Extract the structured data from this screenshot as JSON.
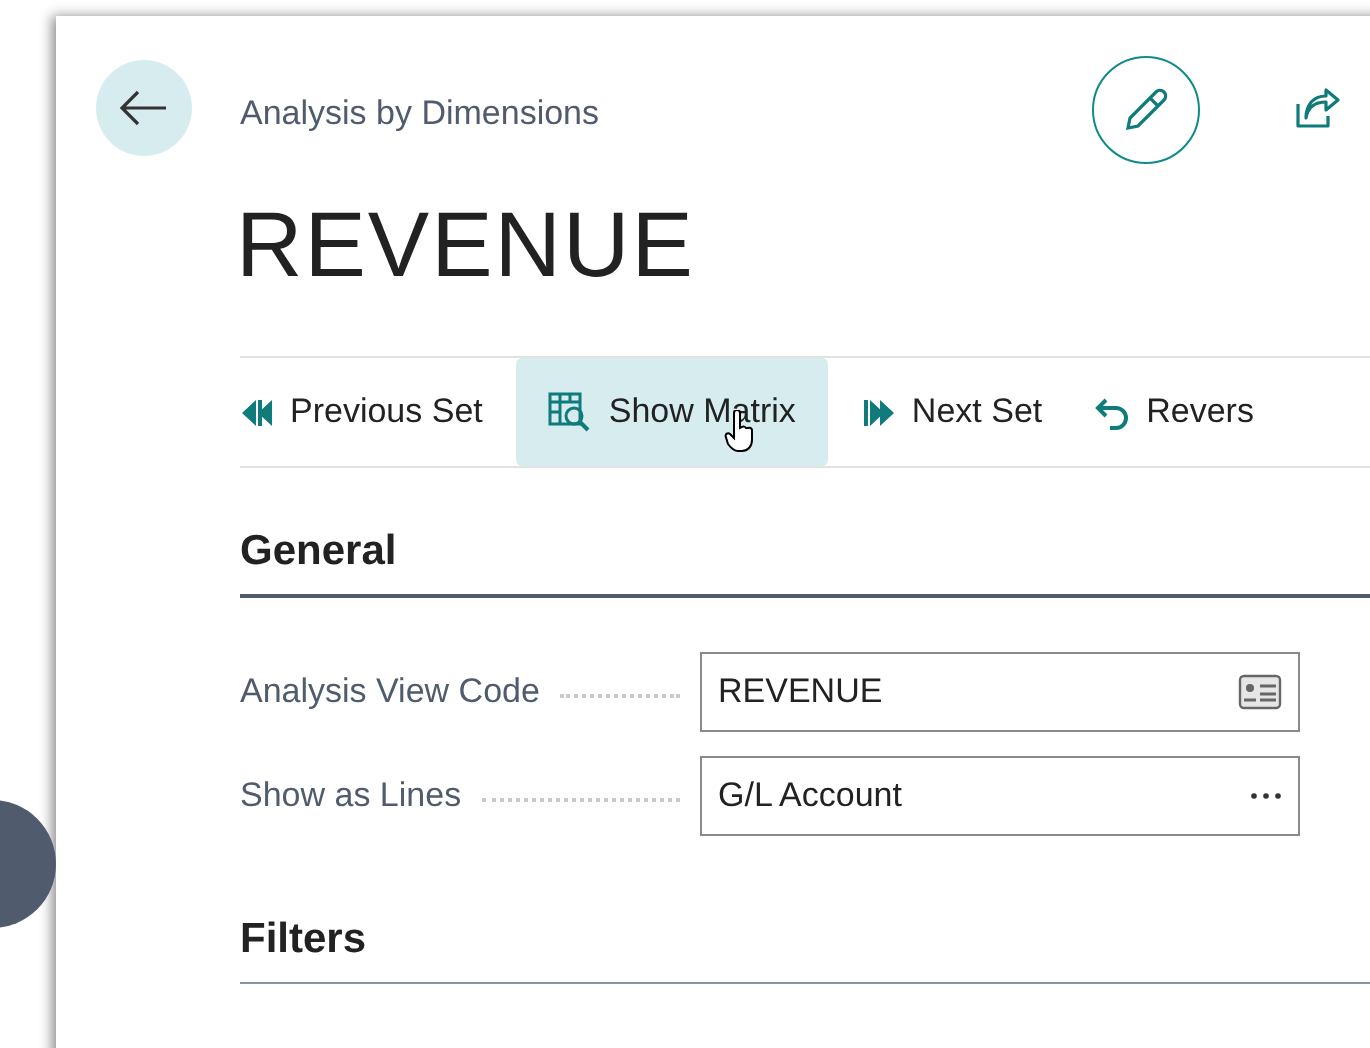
{
  "header": {
    "caption": "Analysis by Dimensions",
    "title": "REVENUE"
  },
  "actions": [
    {
      "label": "Previous Set",
      "kind": "previous",
      "selected": false
    },
    {
      "label": "Show Matrix",
      "kind": "matrix",
      "selected": true
    },
    {
      "label": "Next Set",
      "kind": "next",
      "selected": false
    },
    {
      "label": "Revers",
      "kind": "undo",
      "selected": false
    }
  ],
  "sections": [
    {
      "title": "General",
      "fields": [
        {
          "label": "Analysis View Code",
          "value": "REVENUE",
          "kind": "lookup"
        },
        {
          "label": "Show as Lines",
          "value": "G/L Account",
          "kind": "ellipsis"
        }
      ]
    },
    {
      "title": "Filters"
    }
  ]
}
